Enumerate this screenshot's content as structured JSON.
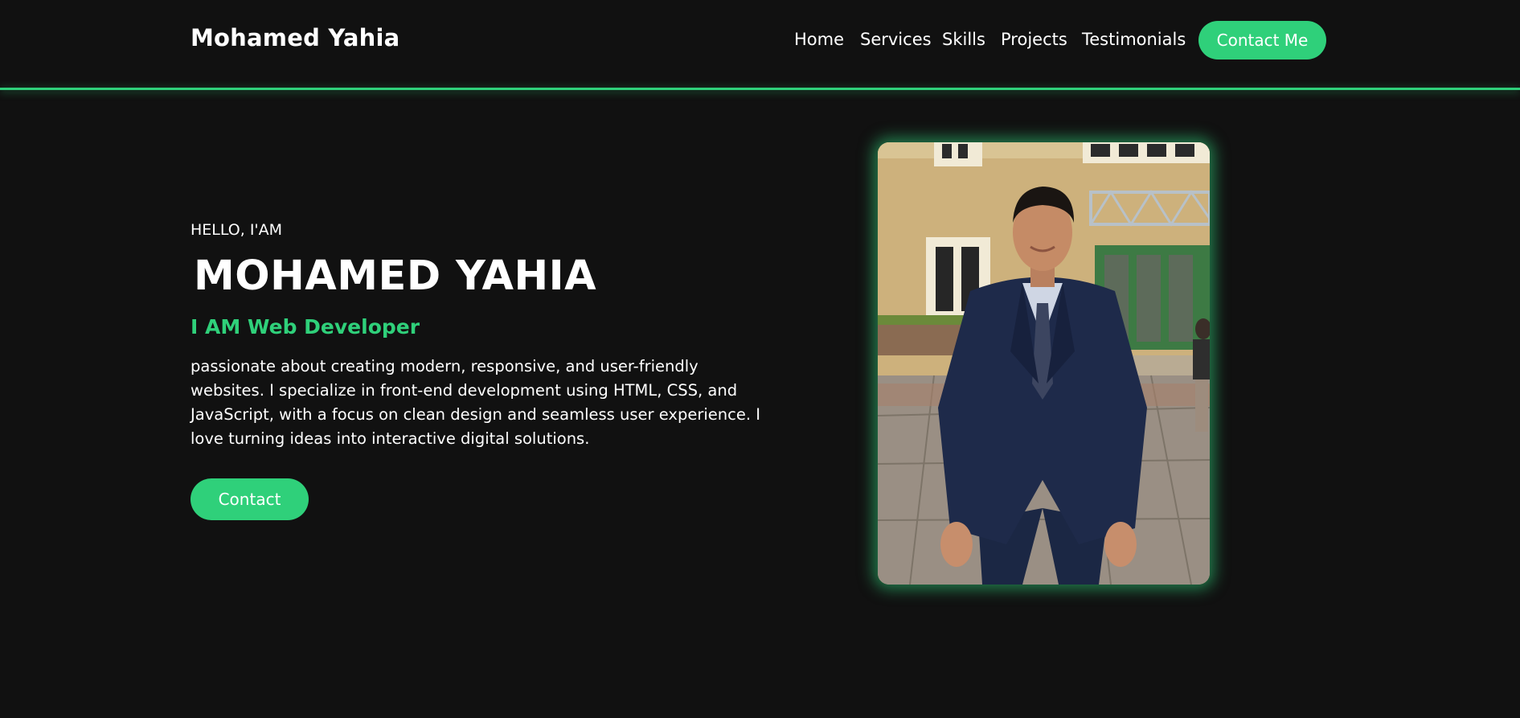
{
  "header": {
    "logo": "Mohamed Yahia",
    "nav": [
      "Home",
      "Services",
      "Skills",
      "Projects",
      "Testimonials"
    ],
    "cta": "Contact Me"
  },
  "hero": {
    "greeting": "HELLO, I'AM",
    "name": "MOHAMED YAHIA",
    "role": "I AM Web Developer",
    "bio": "passionate about creating modern, responsive, and user-friendly websites. I specialize in front-end development using HTML, CSS, and JavaScript, with a focus on clean design and seamless user experience. I love turning ideas into interactive digital solutions.",
    "button": "Contact"
  },
  "colors": {
    "background": "#111111",
    "accent": "#2fd07a",
    "text": "#ffffff"
  }
}
